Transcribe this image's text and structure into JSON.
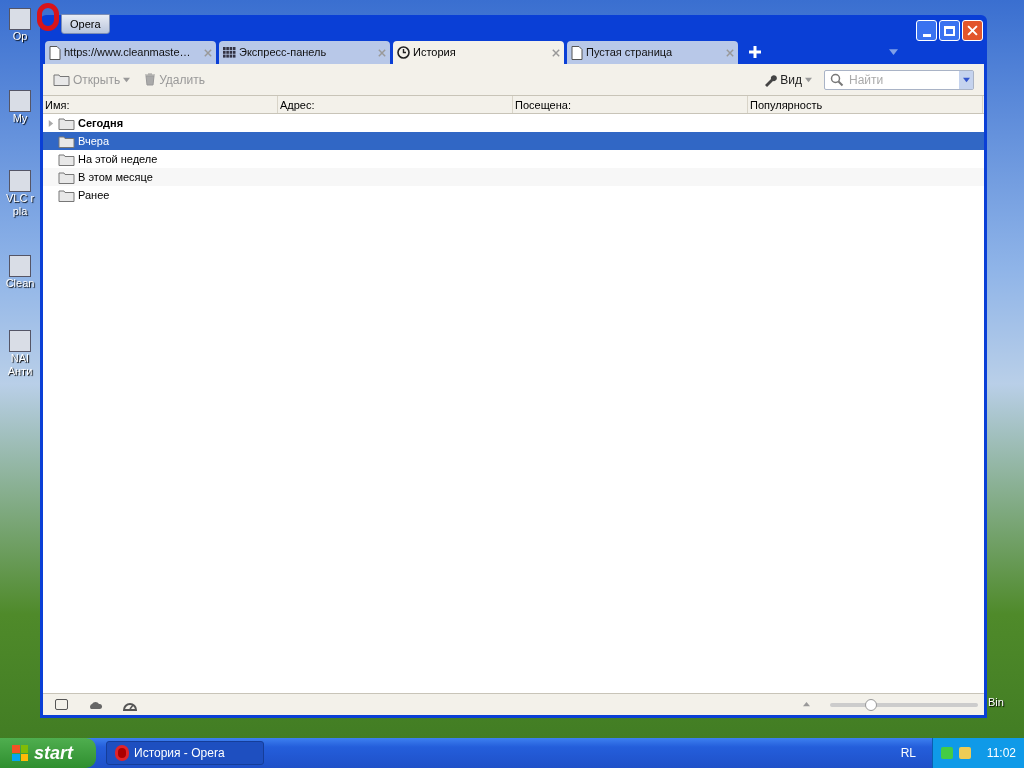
{
  "desktop_icons": [
    {
      "label": "Op"
    },
    {
      "label": "My"
    },
    {
      "label": "VLC r pla"
    },
    {
      "label": "Clean"
    },
    {
      "label": "NAI Анти"
    }
  ],
  "desktop_right_label": "Bin",
  "menu_button": "Opera",
  "tabs": [
    {
      "label": "https://www.cleanmaste…",
      "kind": "page",
      "selected": false
    },
    {
      "label": "Экспресс-панель",
      "kind": "speeddial",
      "selected": false
    },
    {
      "label": "История",
      "kind": "history",
      "selected": true
    },
    {
      "label": "Пустая страница",
      "kind": "page",
      "selected": false
    }
  ],
  "toolbar": {
    "open": "Открыть",
    "delete": "Удалить",
    "view": "Вид",
    "search": {
      "placeholder": "Найти"
    }
  },
  "columns": [
    "Имя:",
    "Адрес:",
    "Посещена:",
    "Популярность"
  ],
  "rows": [
    {
      "name": "Сегодня",
      "bold": true,
      "expandable": true,
      "selected": false
    },
    {
      "name": "Вчера",
      "bold": false,
      "expandable": false,
      "selected": true
    },
    {
      "name": "На этой неделе",
      "bold": false,
      "expandable": false,
      "selected": false
    },
    {
      "name": "В этом месяце",
      "bold": false,
      "expandable": false,
      "selected": false
    },
    {
      "name": "Ранее",
      "bold": false,
      "expandable": false,
      "selected": false
    }
  ],
  "zoom": {
    "level": 0.28
  },
  "taskbar": {
    "start": "start",
    "task": "История - Opera",
    "language": "RL",
    "clock": "11:02"
  }
}
